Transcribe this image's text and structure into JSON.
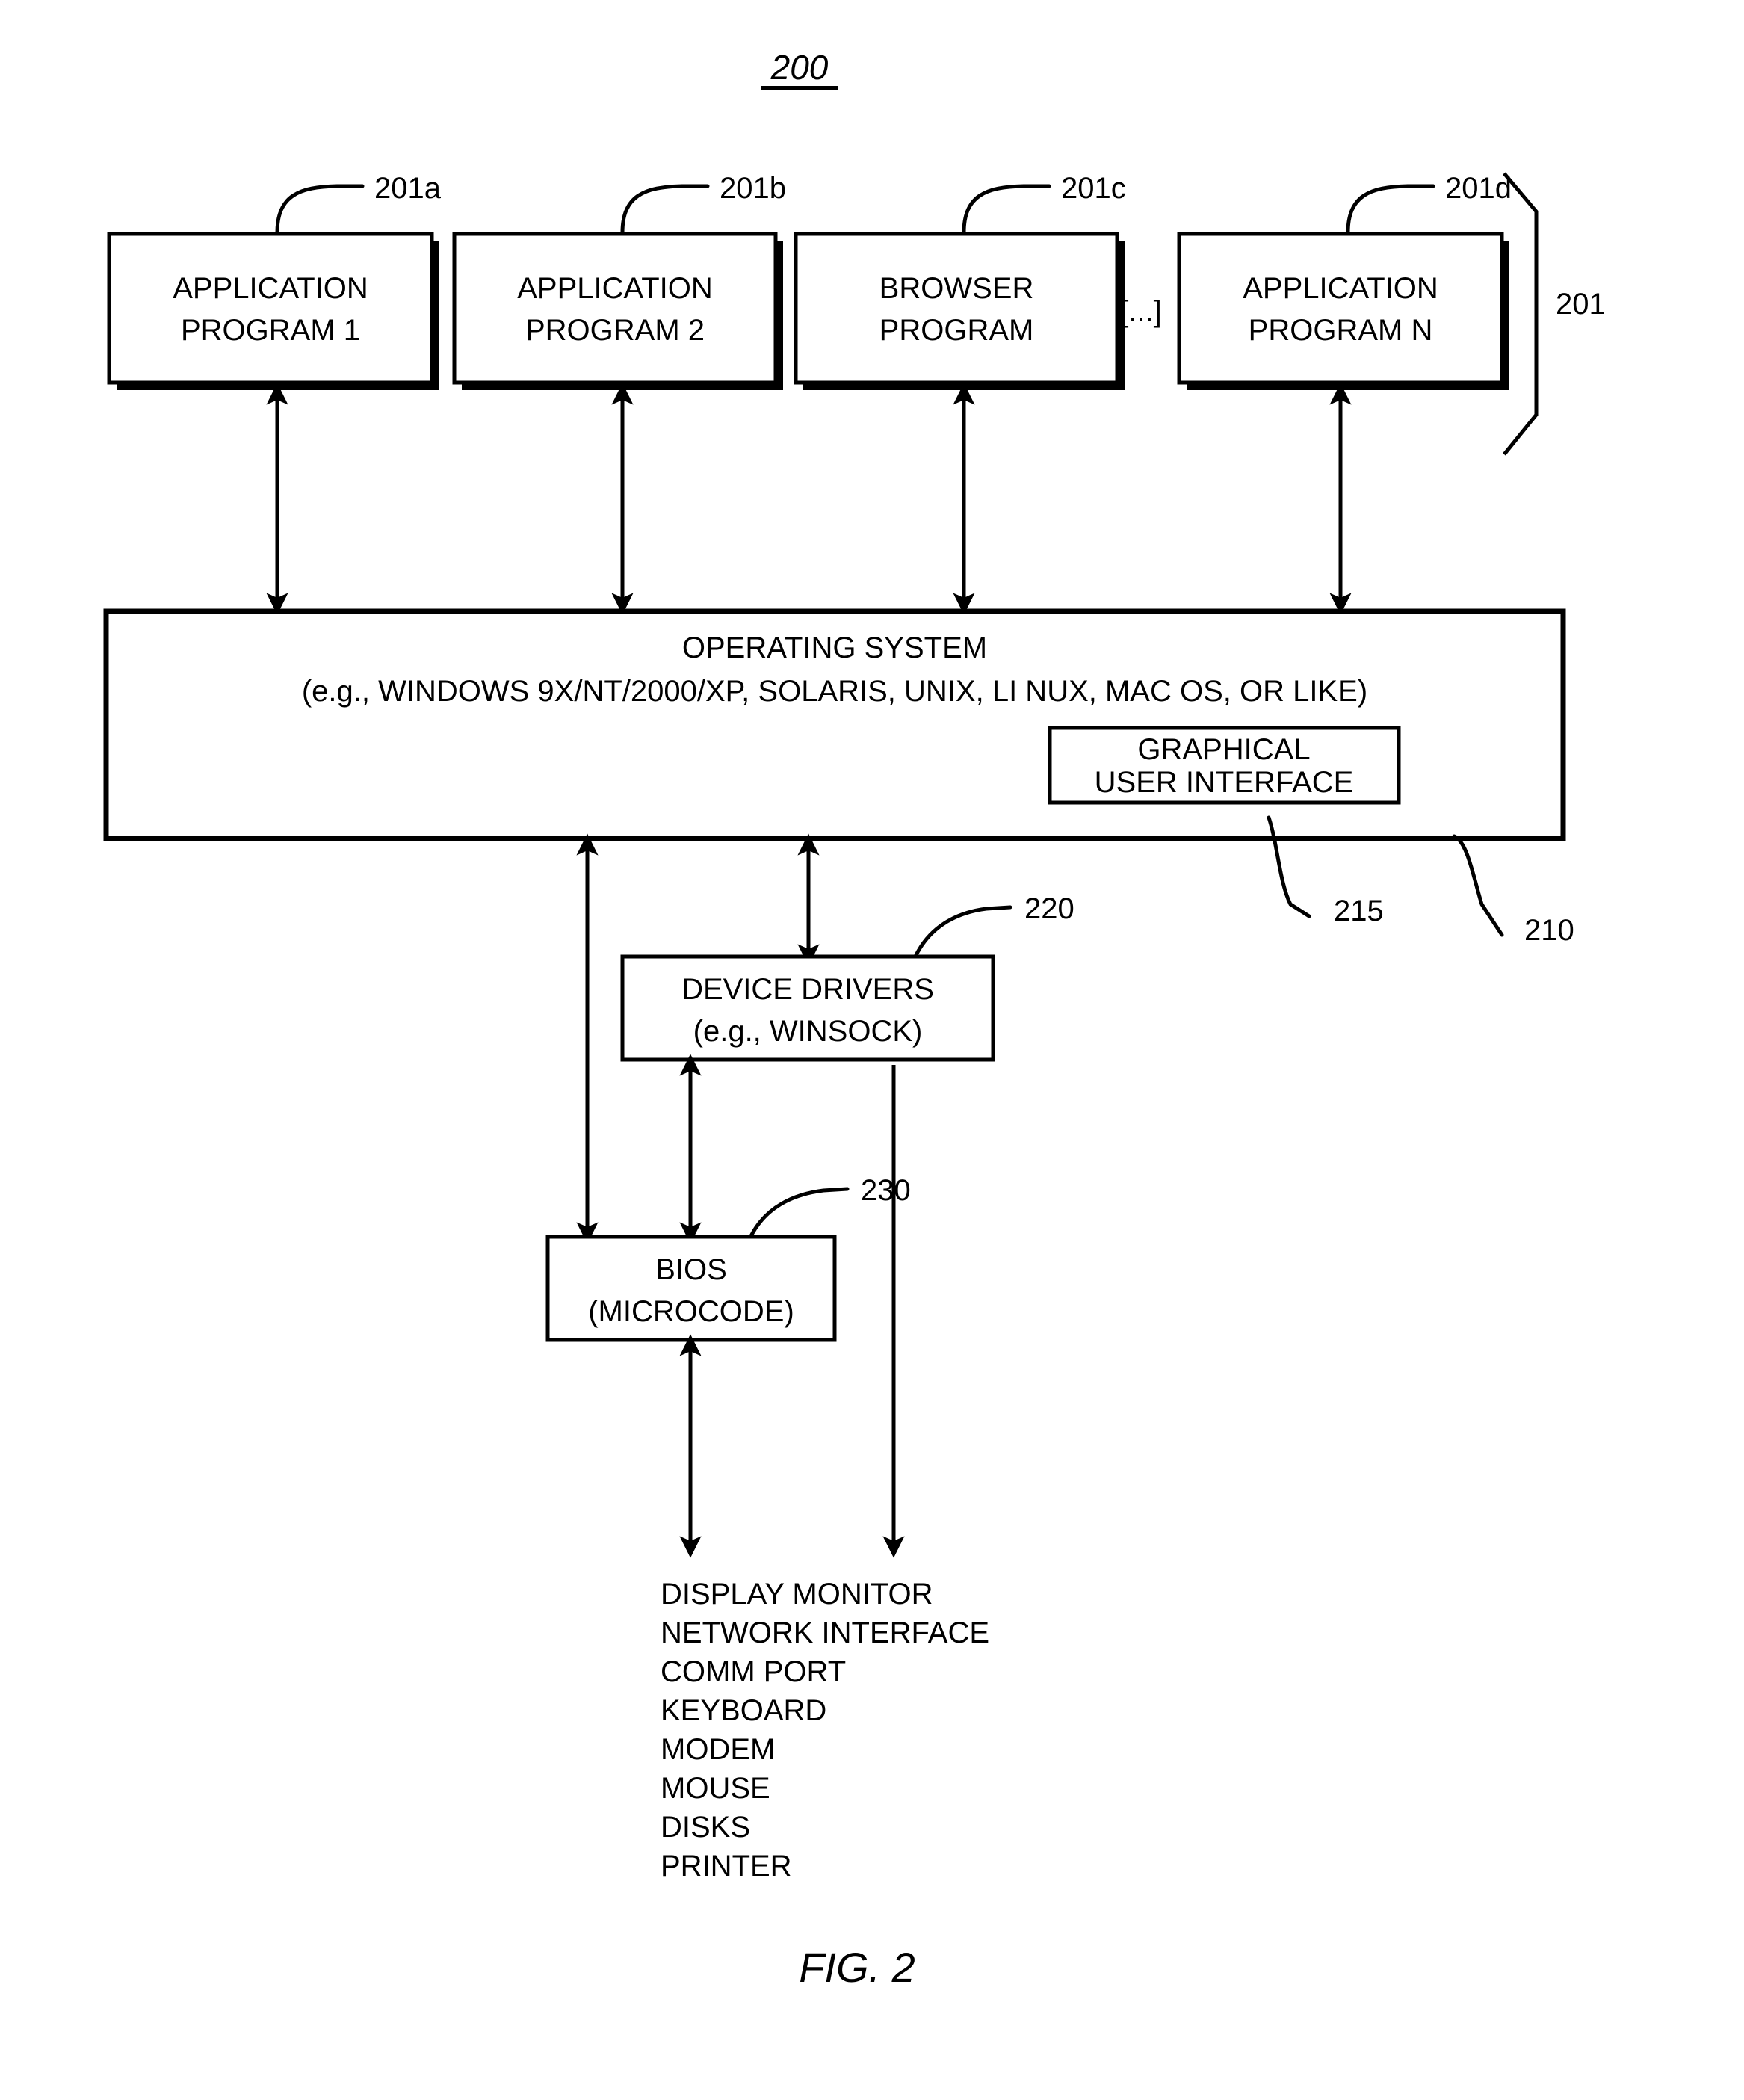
{
  "figure": {
    "number_label": "200",
    "caption": "FIG. 2"
  },
  "application_layer": {
    "group_ref": "201",
    "ellipsis": "[...]",
    "boxes": [
      {
        "ref": "201a",
        "line1": "APPLICATION",
        "line2": "PROGRAM 1"
      },
      {
        "ref": "201b",
        "line1": "APPLICATION",
        "line2": "PROGRAM 2"
      },
      {
        "ref": "201c",
        "line1": "BROWSER",
        "line2": "PROGRAM"
      },
      {
        "ref": "201d",
        "line1": "APPLICATION",
        "line2": "PROGRAM N"
      }
    ]
  },
  "operating_system": {
    "ref": "210",
    "line1": "OPERATING SYSTEM",
    "line2": "(e.g., WINDOWS 9X/NT/2000/XP, SOLARIS, UNIX, LI NUX, MAC OS, OR LIKE)",
    "gui": {
      "ref": "215",
      "line1": "GRAPHICAL",
      "line2": "USER INTERFACE"
    }
  },
  "device_drivers": {
    "ref": "220",
    "line1": "DEVICE DRIVERS",
    "line2": "(e.g., WINSOCK)"
  },
  "bios": {
    "ref": "230",
    "line1": "BIOS",
    "line2": "(MICROCODE)"
  },
  "devices": [
    "DISPLAY MONITOR",
    "NETWORK INTERFACE",
    "COMM PORT",
    "KEYBOARD",
    "MODEM",
    "MOUSE",
    "DISKS",
    "PRINTER"
  ]
}
